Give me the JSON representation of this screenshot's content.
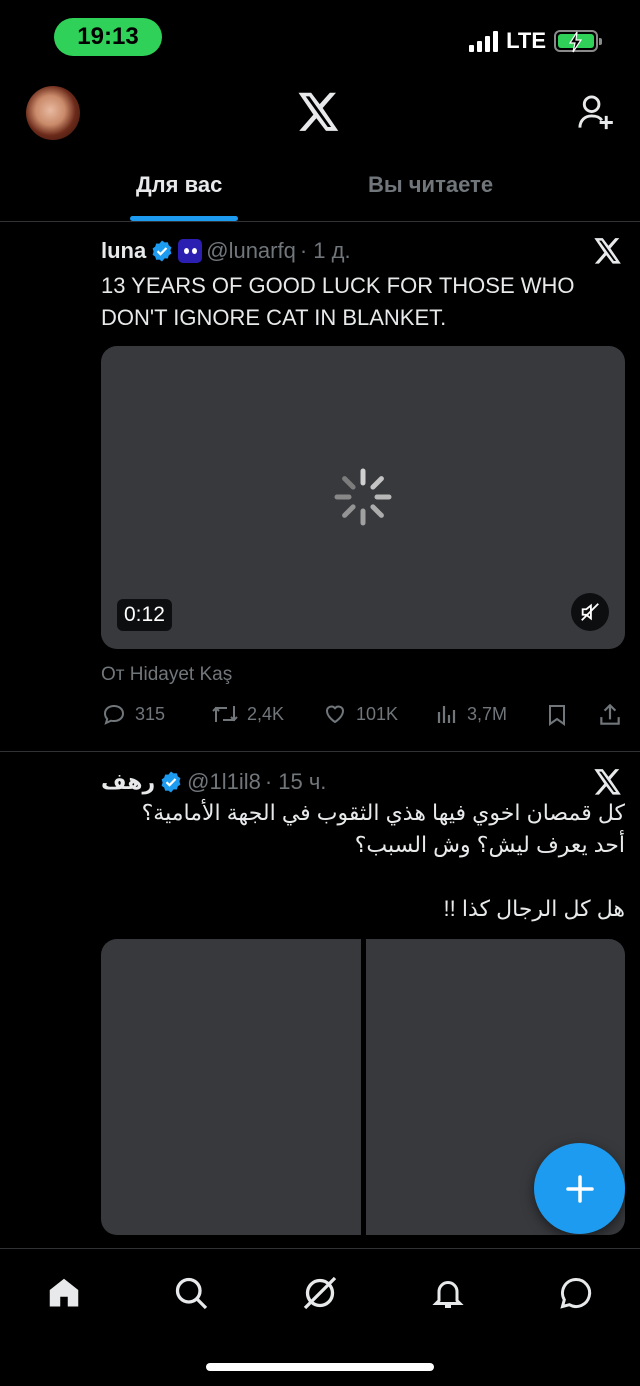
{
  "status_bar": {
    "time": "19:13",
    "network": "LTE",
    "battery_level": 1.0
  },
  "header": {
    "avatar_icon": "profile-avatar",
    "logo_icon": "x-logo-icon",
    "add_user_icon": "add-user-icon"
  },
  "tabs": [
    {
      "label": "Для вас",
      "active": true
    },
    {
      "label": "Вы читаете",
      "active": false
    }
  ],
  "tweets": [
    {
      "name": "luna",
      "handle": "@lunarfq",
      "time": "· 1 д.",
      "text": "13 YEARS OF GOOD LUCK FOR THOSE WHO DON'T IGNORE CAT IN BLANKET.",
      "media": {
        "duration": "0:12",
        "loading": true,
        "muted": true
      },
      "from": "От Hidayet Kaş",
      "stats": {
        "replies": "315",
        "retweets": "2,4K",
        "likes": "101K",
        "views": "3,7M"
      }
    },
    {
      "name": "رهف",
      "handle": "@1l1il8",
      "time": "· 15 ч.",
      "text_lines": [
        "كل قمصان اخوي فيها هذي الثقوب في الجهة الأمامية؟",
        "أحد يعرف ليش؟ وش السبب؟",
        "",
        "هل كل الرجال كذا !!"
      ]
    }
  ],
  "bottom_nav": [
    "home-icon",
    "search-icon",
    "grok-icon",
    "notifications-icon",
    "messages-icon"
  ],
  "colors": {
    "accent": "#1d9bf0",
    "background": "#000000",
    "muted": "#71767b",
    "status_pill": "#2fd158"
  }
}
